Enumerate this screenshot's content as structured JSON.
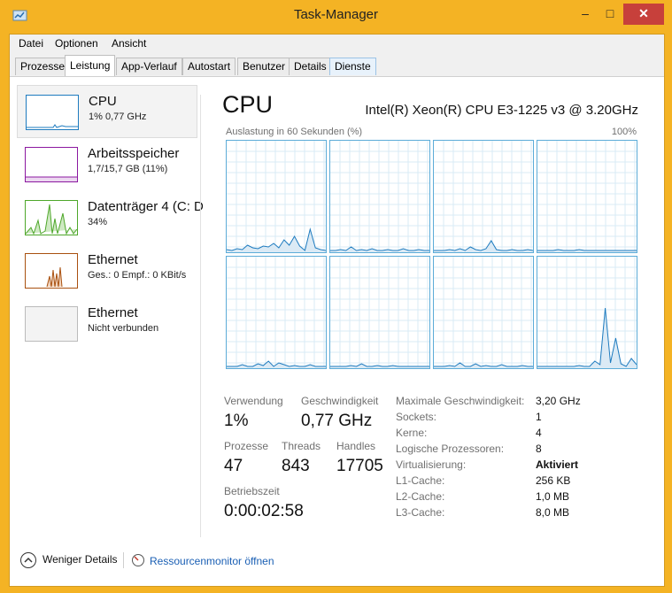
{
  "window": {
    "title": "Task-Manager",
    "min": "–",
    "max": "□",
    "close": "✕"
  },
  "menu": [
    "Datei",
    "Optionen",
    "Ansicht"
  ],
  "tabs": [
    "Prozesse",
    "Leistung",
    "App-Verlauf",
    "Autostart",
    "Benutzer",
    "Details",
    "Dienste"
  ],
  "sidebar": [
    {
      "title": "CPU",
      "sub": "1% 0,77 GHz",
      "color": "#1e7bbf"
    },
    {
      "title": "Arbeitsspeicher",
      "sub": "1,7/15,7 GB (11%)",
      "color": "#8b18a0"
    },
    {
      "title": "Datenträger 4 (C: D",
      "sub": "34%",
      "color": "#4ea72a"
    },
    {
      "title": "Ethernet",
      "sub": "Ges.: 0 Empf.: 0 KBit/s",
      "color": "#a9500f"
    },
    {
      "title": "Ethernet",
      "sub": "Nicht verbunden",
      "color": "#bbbbbb"
    }
  ],
  "main": {
    "title": "CPU",
    "model": "Intel(R) Xeon(R) CPU E3-1225 v3 @ 3.20GHz",
    "util_label": "Auslastung in 60 Sekunden (%)",
    "pct": "100%",
    "graph_color": "#1e7bbf"
  },
  "stats": {
    "usage_label": "Verwendung",
    "usage": "1%",
    "speed_label": "Geschwindigkeit",
    "speed": "0,77 GHz",
    "proc_label": "Prozesse",
    "proc": "47",
    "threads_label": "Threads",
    "threads": "843",
    "handles_label": "Handles",
    "handles": "17705",
    "uptime_label": "Betriebszeit",
    "uptime": "0:00:02:58"
  },
  "info": [
    {
      "label": "Maximale Geschwindigkeit:",
      "value": "3,20 GHz",
      "bold": false
    },
    {
      "label": "Sockets:",
      "value": "1",
      "bold": false
    },
    {
      "label": "Kerne:",
      "value": "4",
      "bold": false
    },
    {
      "label": "Logische Prozessoren:",
      "value": "8",
      "bold": false
    },
    {
      "label": "Virtualisierung:",
      "value": "Aktiviert",
      "bold": true
    },
    {
      "label": "L1-Cache:",
      "value": "256 KB",
      "bold": false
    },
    {
      "label": "L2-Cache:",
      "value": "1,0 MB",
      "bold": false
    },
    {
      "label": "L3-Cache:",
      "value": "8,0 MB",
      "bold": false
    }
  ],
  "footer": {
    "fewer": "Weniger Details",
    "resmon": "Ressourcenmonitor öffnen"
  }
}
